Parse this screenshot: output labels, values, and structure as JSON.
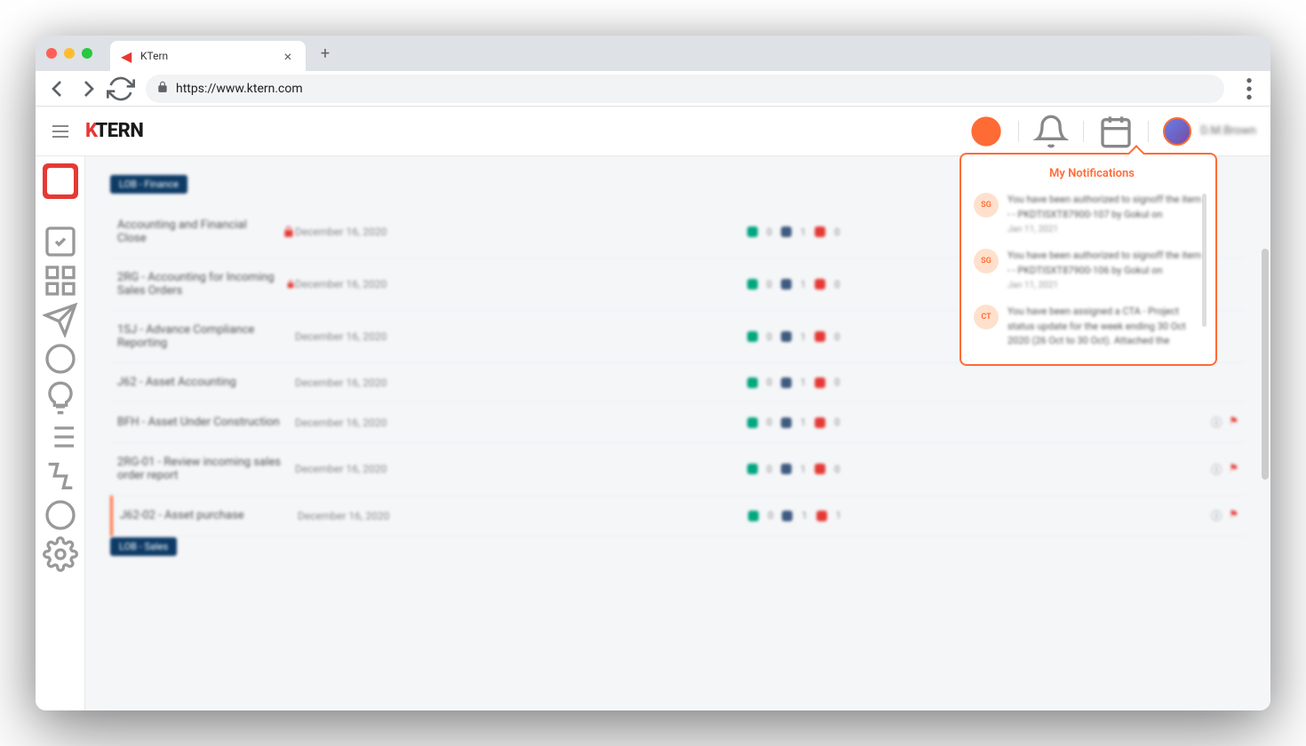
{
  "browser": {
    "tab_title": "KTern",
    "url": "https://www.ktern.com"
  },
  "header": {
    "logo_text": "TERN",
    "username": "D.M.Brown"
  },
  "sidebar": {
    "items": [
      {
        "name": "dashboard"
      },
      {
        "name": "tasks"
      },
      {
        "name": "grid"
      },
      {
        "name": "send"
      },
      {
        "name": "circle"
      },
      {
        "name": "bulb"
      },
      {
        "name": "list"
      },
      {
        "name": "transform"
      },
      {
        "name": "loop"
      },
      {
        "name": "settings"
      }
    ]
  },
  "groups": [
    {
      "label": "LOB - Finance",
      "rows": [
        {
          "name": "Accounting and Financial Close",
          "locked": true,
          "date": "December 16, 2020",
          "s1": 0,
          "s2": 1,
          "s3": 0
        },
        {
          "name": "2RG - Accounting for Incoming Sales Orders",
          "locked": true,
          "date": "December 16, 2020",
          "s1": 0,
          "s2": 1,
          "s3": 0
        },
        {
          "name": "1SJ - Advance Compliance Reporting",
          "locked": false,
          "date": "December 16, 2020",
          "s1": 0,
          "s2": 1,
          "s3": 0
        },
        {
          "name": "J62 - Asset Accounting",
          "locked": false,
          "date": "December 16, 2020",
          "s1": 0,
          "s2": 1,
          "s3": 0
        },
        {
          "name": "BFH - Asset Under Construction",
          "locked": false,
          "date": "December 16, 2020",
          "s1": 0,
          "s2": 1,
          "s3": 0,
          "actions": true
        },
        {
          "name": "2RG-01 - Review incoming sales order report",
          "locked": false,
          "date": "December 16, 2020",
          "s1": 0,
          "s2": 1,
          "s3": 0,
          "actions": true
        },
        {
          "name": "J62-02 - Asset purchase",
          "locked": false,
          "date": "December 16, 2020",
          "s1": 0,
          "s2": 1,
          "s3": 1,
          "actions": true,
          "highlighted": true
        }
      ]
    },
    {
      "label": "LOB - Sales",
      "rows": []
    }
  ],
  "notifications": {
    "title": "My Notifications",
    "items": [
      {
        "avatar": "SG",
        "text": "You have been authorized to signoff the item - - PKDTISXT87900-107 by Gokul on",
        "date": "Jan 11, 2021"
      },
      {
        "avatar": "SG",
        "text": "You have been authorized to signoff the item - - PKDTISXT87900-106 by Gokul on",
        "date": "Jan 11, 2021"
      },
      {
        "avatar": "CT",
        "text": "You have been assigned a CTA - Project status update for the week ending 30 Oct 2020 (26 Oct to 30 Oct). Attached the",
        "date": ""
      }
    ]
  }
}
